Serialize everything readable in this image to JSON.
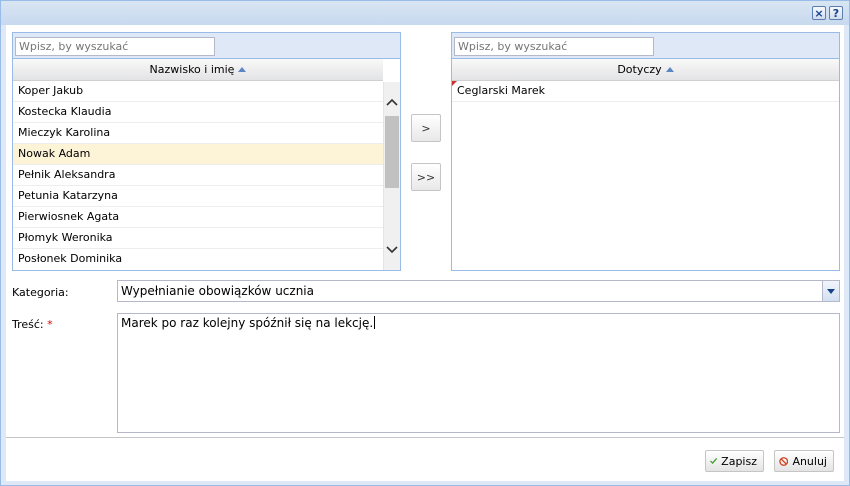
{
  "window": {
    "close_icon": "×",
    "help_icon": "?"
  },
  "left_list": {
    "search_placeholder": "Wpisz, by wyszukać",
    "column_header": "Nazwisko i imię",
    "rows": [
      "Koper Jakub",
      "Kostecka Klaudia",
      "Mieczyk Karolina",
      "Nowak Adam",
      "Pełnik Aleksandra",
      "Petunia Katarzyna",
      "Pierwiosnek Agata",
      "Płomyk Weronika",
      "Posłonek Dominika"
    ],
    "selected_index": 3
  },
  "move_buttons": {
    "move_one": ">",
    "move_all": ">>"
  },
  "right_list": {
    "search_placeholder": "Wpisz, by wyszukać",
    "column_header": "Dotyczy",
    "rows": [
      "Ceglarski Marek"
    ]
  },
  "form": {
    "category_label": "Kategoria:",
    "category_value": "Wypełnianie obowiązków ucznia",
    "content_label": "Treść:",
    "required_mark": "*",
    "content_value": "Marek po raz kolejny spóźnił się na lekcję."
  },
  "footer": {
    "save_label": "Zapisz",
    "cancel_label": "Anuluj"
  },
  "colors": {
    "accent": "#99bbe8",
    "selected_row": "#fdf4d8",
    "save_icon": "#3a9a2a",
    "cancel_icon": "#d04020"
  }
}
